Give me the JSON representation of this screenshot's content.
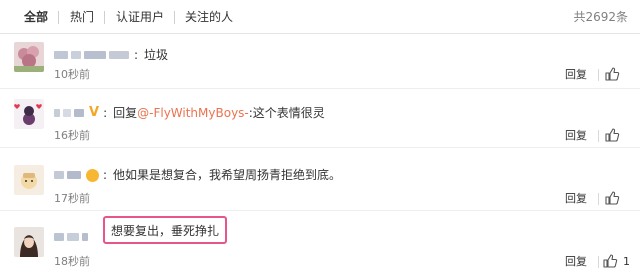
{
  "tabs": [
    {
      "label": "全部"
    },
    {
      "label": "热门"
    },
    {
      "label": "认证用户"
    },
    {
      "label": "关注的人"
    }
  ],
  "total": "共2692条",
  "comments": [
    {
      "text": "垃圾",
      "time": "10秒前",
      "reply_label": "回复"
    },
    {
      "reply_prefix": "回复",
      "mention": "@-FlyWithMyBoys-",
      "text": ":这个表情很灵",
      "time": "16秒前",
      "reply_label": "回复"
    },
    {
      "text": "他如果是想复合，我希望周扬青拒绝到底。",
      "time": "17秒前",
      "reply_label": "回复"
    },
    {
      "text": "想要复出，垂死挣扎",
      "time": "18秒前",
      "reply_label": "回复",
      "likes": "1"
    }
  ],
  "colors": {
    "link": "#eb7350",
    "highlight_border": "#e8548c",
    "verified": "#f5a623"
  }
}
